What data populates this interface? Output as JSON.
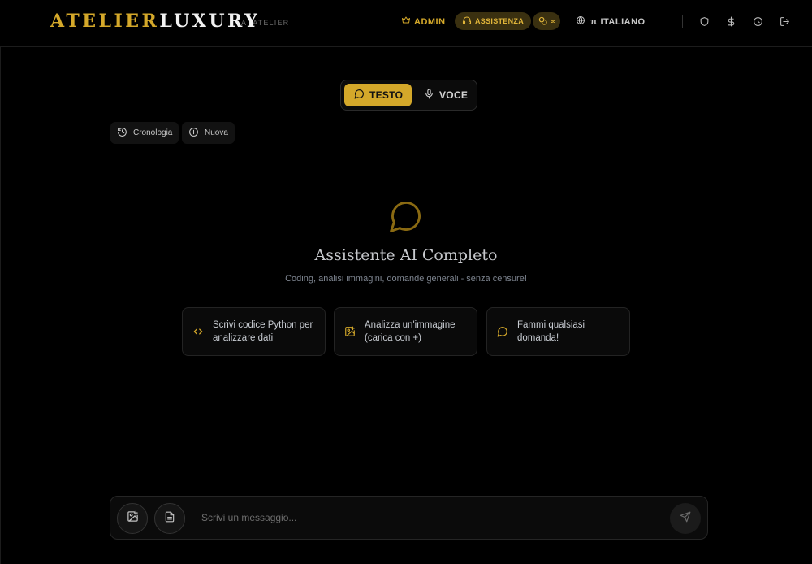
{
  "brand": {
    "logo_part1": "ATELIER",
    "logo_part2": "LUXURY",
    "subtitle": "AI ATELIER",
    "accent": "#d4a82a"
  },
  "header": {
    "admin_label": "ADMIN",
    "assist_label": "ASSISTENZA",
    "credits_label": "∞",
    "language_label": "π ITALIANO",
    "icons": [
      "shield-icon",
      "dollar-icon",
      "clock-icon",
      "logout-icon"
    ]
  },
  "mode": {
    "text_label": "TESTO",
    "voice_label": "VOCE",
    "selected": "TESTO"
  },
  "actions": {
    "history_label": "Cronologia",
    "new_label": "Nuova"
  },
  "empty_state": {
    "title": "Assistente AI Completo",
    "subtitle": "Coding, analisi immagini, domande generali - senza censure!"
  },
  "suggestions": [
    {
      "icon": "code-icon",
      "line1": "Scrivi codice Python per",
      "line2": "analizzare dati"
    },
    {
      "icon": "image-plus-icon",
      "line1": "Analizza un'immagine",
      "line2": "(carica con +)"
    },
    {
      "icon": "chat-icon",
      "line1": "Fammi qualsiasi",
      "line2": "domanda!"
    }
  ],
  "composer": {
    "placeholder": "Scrivi un messaggio...",
    "value": ""
  }
}
